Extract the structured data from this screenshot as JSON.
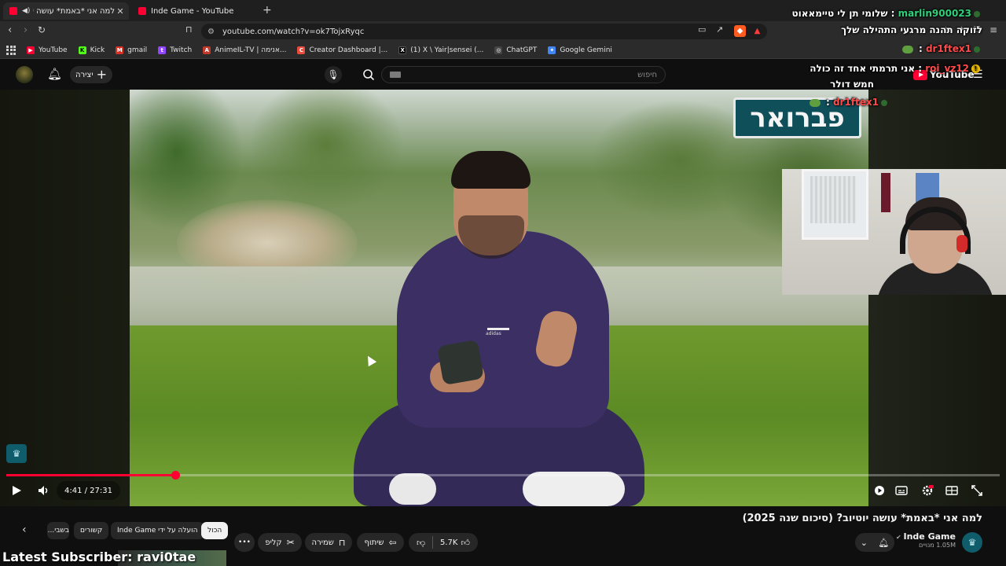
{
  "browser": {
    "tabs": [
      {
        "title": "למה אני *באמת* עושה יוטיוב?",
        "active": true,
        "audio": true
      },
      {
        "title": "Inde Game - YouTube",
        "active": false,
        "audio": false
      }
    ],
    "new_tab": "+",
    "url": "youtube.com/watch?v=ok7TojxRyqc",
    "bookmarks": [
      {
        "label": "YouTube",
        "color": "#ff0033",
        "glyph": "▶"
      },
      {
        "label": "Kick",
        "color": "#53fc18",
        "glyph": "K"
      },
      {
        "label": "gmail",
        "color": "#d93025",
        "glyph": "M"
      },
      {
        "label": "Twitch",
        "color": "#9146ff",
        "glyph": "t"
      },
      {
        "label": "AnimeIL-TV | אנימה...",
        "color": "#c0392b",
        "glyph": "A"
      },
      {
        "label": "Creator Dashboard |...",
        "color": "#e74c3c",
        "glyph": "C"
      },
      {
        "label": "(1) X \\ Yair|sensei (...",
        "color": "#000000",
        "glyph": "X"
      },
      {
        "label": "ChatGPT",
        "color": "#444444",
        "glyph": "◎"
      },
      {
        "label": "Google Gemini",
        "color": "#4285f4",
        "glyph": "✦"
      }
    ]
  },
  "masthead": {
    "create_label": "יצירה",
    "search_placeholder": "חיפוש",
    "logo_text": "YouTube"
  },
  "video": {
    "month_overlay": "פברואר",
    "current_time": "4:41",
    "duration": "27:31",
    "time_display": "4:41 / 27:31",
    "progress": 0.1703
  },
  "chat": [
    {
      "user": "marlin900023",
      "user_color": "#2fd07a",
      "text": "שלומי תן לי טיימאאוט",
      "sep": " : "
    },
    {
      "user": "",
      "user_color": "#ffffff",
      "text": "לזוקה תהנה מרגעי התהילה שלך",
      "sep": ""
    },
    {
      "user": "dr1ftex1",
      "user_color": "#ff4a4a",
      "text": "",
      "sep": " : "
    },
    {
      "user": "roi_vz12",
      "user_color": "#ff4a4a",
      "text": "אני תרמתי אחד זה כולה",
      "sep": " : "
    },
    {
      "user": "",
      "user_color": "#ffffff",
      "text": "חמש דולר",
      "sep": ""
    },
    {
      "user": "dr1ftex1",
      "user_color": "#ff4a4a",
      "text": "",
      "sep": " : "
    }
  ],
  "below": {
    "title": "למה אני *באמת* עושה יוטיוב? (סיכום שנה 2025)",
    "channel_name": "Inde Game",
    "channel_subs": "1.05M מנויים",
    "likes": "5.7K",
    "share_label": "שיתוף",
    "save_label": "שמירה",
    "clip_label": "קליפ",
    "more_label": "•••",
    "chips": [
      {
        "label": "הכול",
        "active": true
      },
      {
        "label": "הועלה על ידי Inde Game",
        "active": false
      },
      {
        "label": "קשורים",
        "active": false
      },
      {
        "label": "בשבי...",
        "active": false
      }
    ]
  },
  "overlay": {
    "latest_subscriber": "Latest Subscriber: ravi0...",
    "latest_sub_visible": "Latest Subscriber: ravi0tae"
  },
  "colors": {
    "accent": "#ff0033",
    "background": "#0f0f0f",
    "pill": "#272727"
  }
}
